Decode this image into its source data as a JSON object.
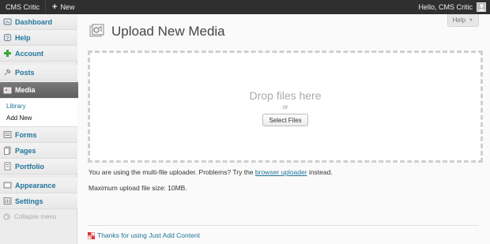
{
  "adminbar": {
    "site_name": "CMS Critic",
    "new_label": "New",
    "greeting": "Hello, CMS Critic"
  },
  "sidebar": {
    "items": [
      {
        "label": "Dashboard",
        "icon": "dashboard-icon"
      },
      {
        "label": "Help",
        "icon": "help-icon"
      },
      {
        "label": "Account",
        "icon": "plus-icon"
      },
      {
        "label": "Posts",
        "icon": "pin-icon"
      },
      {
        "label": "Media",
        "icon": "media-icon",
        "current": true
      },
      {
        "label": "Forms",
        "icon": "forms-icon"
      },
      {
        "label": "Pages",
        "icon": "pages-icon"
      },
      {
        "label": "Portfolio",
        "icon": "portfolio-icon"
      },
      {
        "label": "Appearance",
        "icon": "appearance-icon"
      },
      {
        "label": "Settings",
        "icon": "settings-icon"
      }
    ],
    "submenu": [
      {
        "label": "Library"
      },
      {
        "label": "Add New",
        "active": true
      }
    ],
    "collapse_label": "Collapse menu"
  },
  "main": {
    "help_tab": "Help",
    "title": "Upload New Media",
    "dropzone": {
      "drop_text": "Drop files here",
      "or_text": "or",
      "select_button": "Select Files"
    },
    "uploader_note": {
      "before": "You are using the multi-file uploader. Problems? Try the ",
      "link": "browser uploader",
      "after": " instead."
    },
    "max_size": "Maximum upload file size: 10MB.",
    "footer": "Thanks for using Just Add Content"
  },
  "colors": {
    "link": "#21759b",
    "adminbar": "#2f2f2f",
    "current_menu": "#6b6b6b"
  }
}
